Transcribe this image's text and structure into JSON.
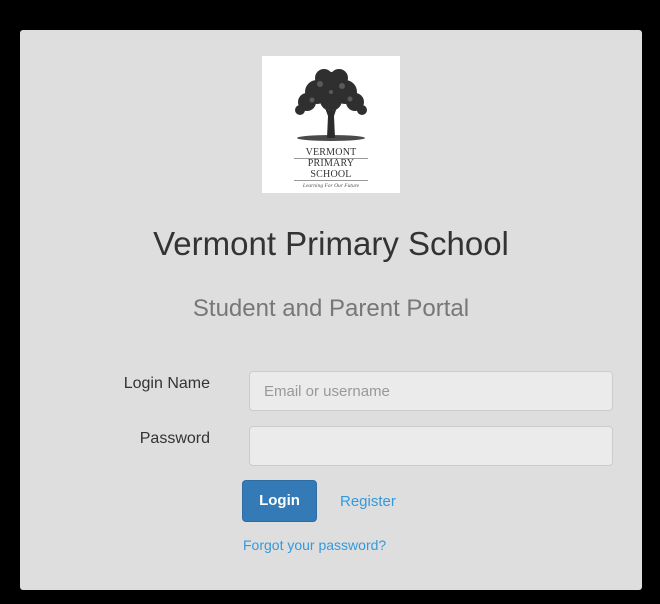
{
  "logo": {
    "line1": "VERMONT",
    "line2": "PRIMARY",
    "line3": "SCHOOL",
    "tagline": "Learning For Our Future"
  },
  "header": {
    "title": "Vermont Primary School",
    "subtitle": "Student and Parent Portal"
  },
  "form": {
    "login_label": "Login Name",
    "login_placeholder": "Email or username",
    "login_value": "",
    "password_label": "Password",
    "password_value": ""
  },
  "actions": {
    "login_label": "Login",
    "register_label": "Register",
    "forgot_label": "Forgot your password?"
  },
  "colors": {
    "background": "#000000",
    "panel": "#dedede",
    "primary_button": "#337ab7",
    "link": "#3399dd"
  },
  "icons": {
    "logo_graphic": "oak-tree-icon"
  }
}
